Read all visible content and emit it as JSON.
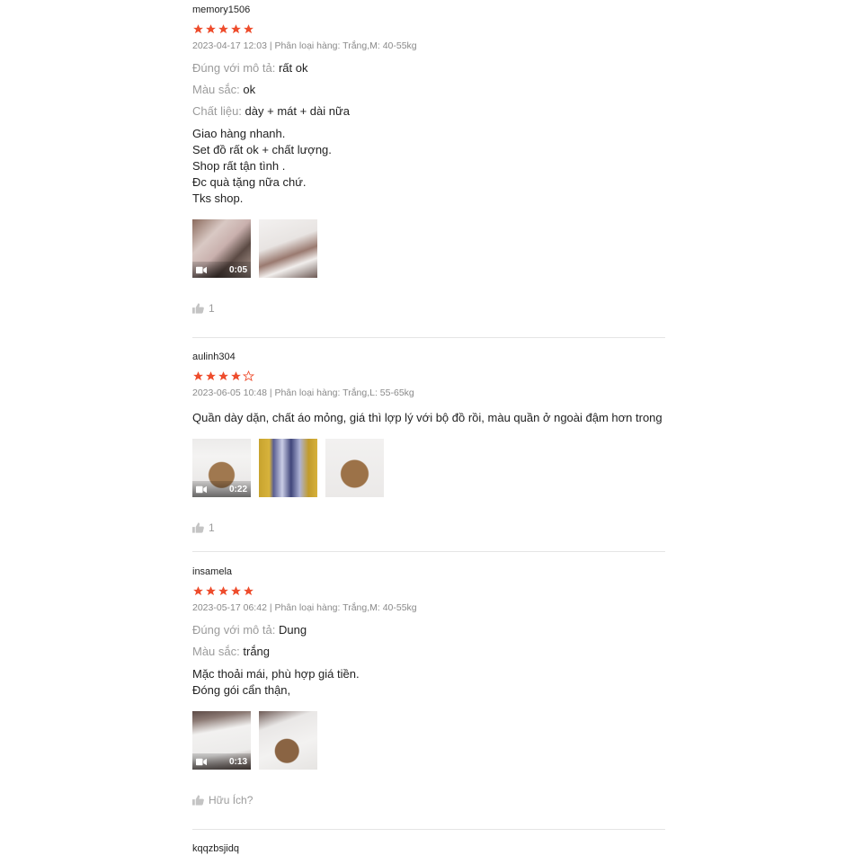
{
  "colors": {
    "star": "#ee4d2d",
    "muted": "#9b9b9b",
    "divider": "#e5e5e5"
  },
  "reviews": [
    {
      "username": "memory1506",
      "rating": 5,
      "meta": "2023-04-17 12:03 | Phân loại hàng: Trắng,M: 40-55kg",
      "attributes": [
        {
          "label": "Đúng với mô tả:",
          "value": "rất ok"
        },
        {
          "label": "Màu sắc:",
          "value": "ok"
        },
        {
          "label": "Chất liệu:",
          "value": "dày + mát + dài nữa"
        }
      ],
      "body": "Giao hàng nhanh.\nSet đồ rất ok + chất lượng.\nShop rất tận tình .\nĐc quà tặng nữa chứ.\nTks shop.",
      "media": [
        {
          "type": "video",
          "duration": "0:05",
          "icon": "video-camera-icon"
        },
        {
          "type": "image"
        }
      ],
      "likes": "1"
    },
    {
      "username": "aulinh304",
      "rating": 4,
      "meta": "2023-06-05 10:48 | Phân loại hàng: Trắng,L: 55-65kg",
      "attributes": [],
      "body": "Quần dày dặn, chất áo mỏng, giá thì lợp lý với bộ đồ rồi, màu quần ở ngoài đậm hơn trong hìn",
      "media": [
        {
          "type": "video",
          "duration": "0:22",
          "icon": "video-camera-icon"
        },
        {
          "type": "image"
        },
        {
          "type": "image"
        }
      ],
      "likes": "1"
    },
    {
      "username": "insamela",
      "rating": 5,
      "meta": "2023-05-17 06:42 | Phân loại hàng: Trắng,M: 40-55kg",
      "attributes": [
        {
          "label": "Đúng với mô tả:",
          "value": "Dung"
        },
        {
          "label": "Màu sắc:",
          "value": "trắng"
        }
      ],
      "body": "Mặc thoải mái, phù hợp giá tiền.\nĐóng gói cẩn thận,",
      "media": [
        {
          "type": "video",
          "duration": "0:13",
          "icon": "video-camera-icon"
        },
        {
          "type": "image"
        }
      ],
      "likes": "Hữu Ích?"
    },
    {
      "username": "kqqzbsjidq"
    }
  ]
}
